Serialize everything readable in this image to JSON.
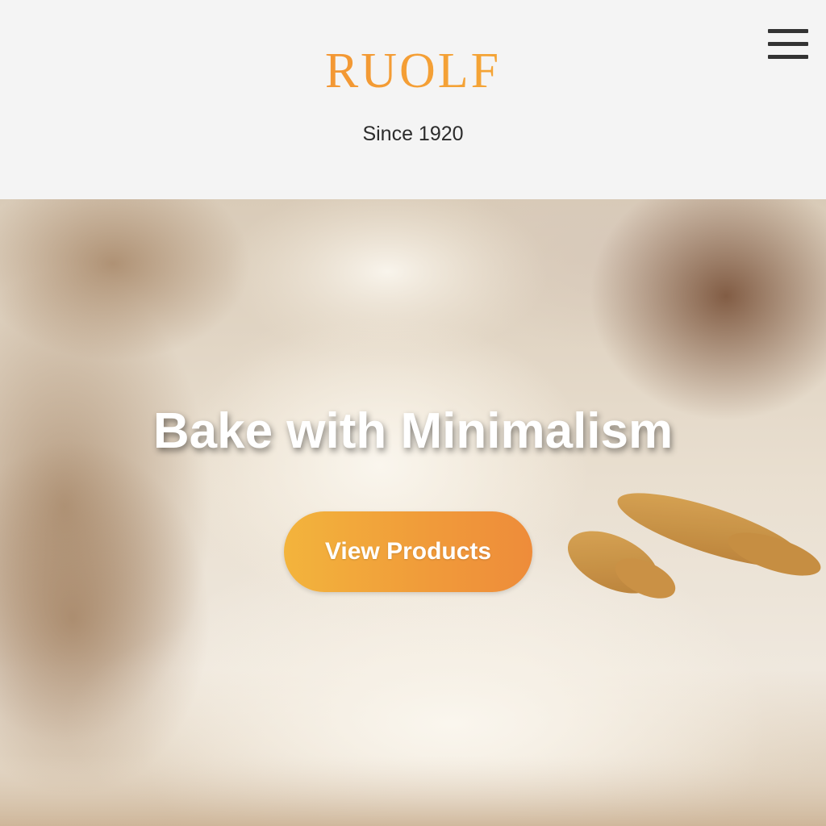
{
  "header": {
    "logo": "RUOLF",
    "tagline": "Since 1920",
    "menu_icon": "hamburger-menu-icon"
  },
  "hero": {
    "image": "flour-sack-and-wheat-photo",
    "title": "Bake with Minimalism",
    "cta_label": "View Products"
  },
  "colors": {
    "logo_gradient": [
      "#f07b2e",
      "#f6b63a"
    ],
    "cta_gradient": [
      "#f3b43c",
      "#ee8c3a"
    ],
    "header_bg": "#f4f4f4",
    "tagline": "#2c2c2c"
  }
}
